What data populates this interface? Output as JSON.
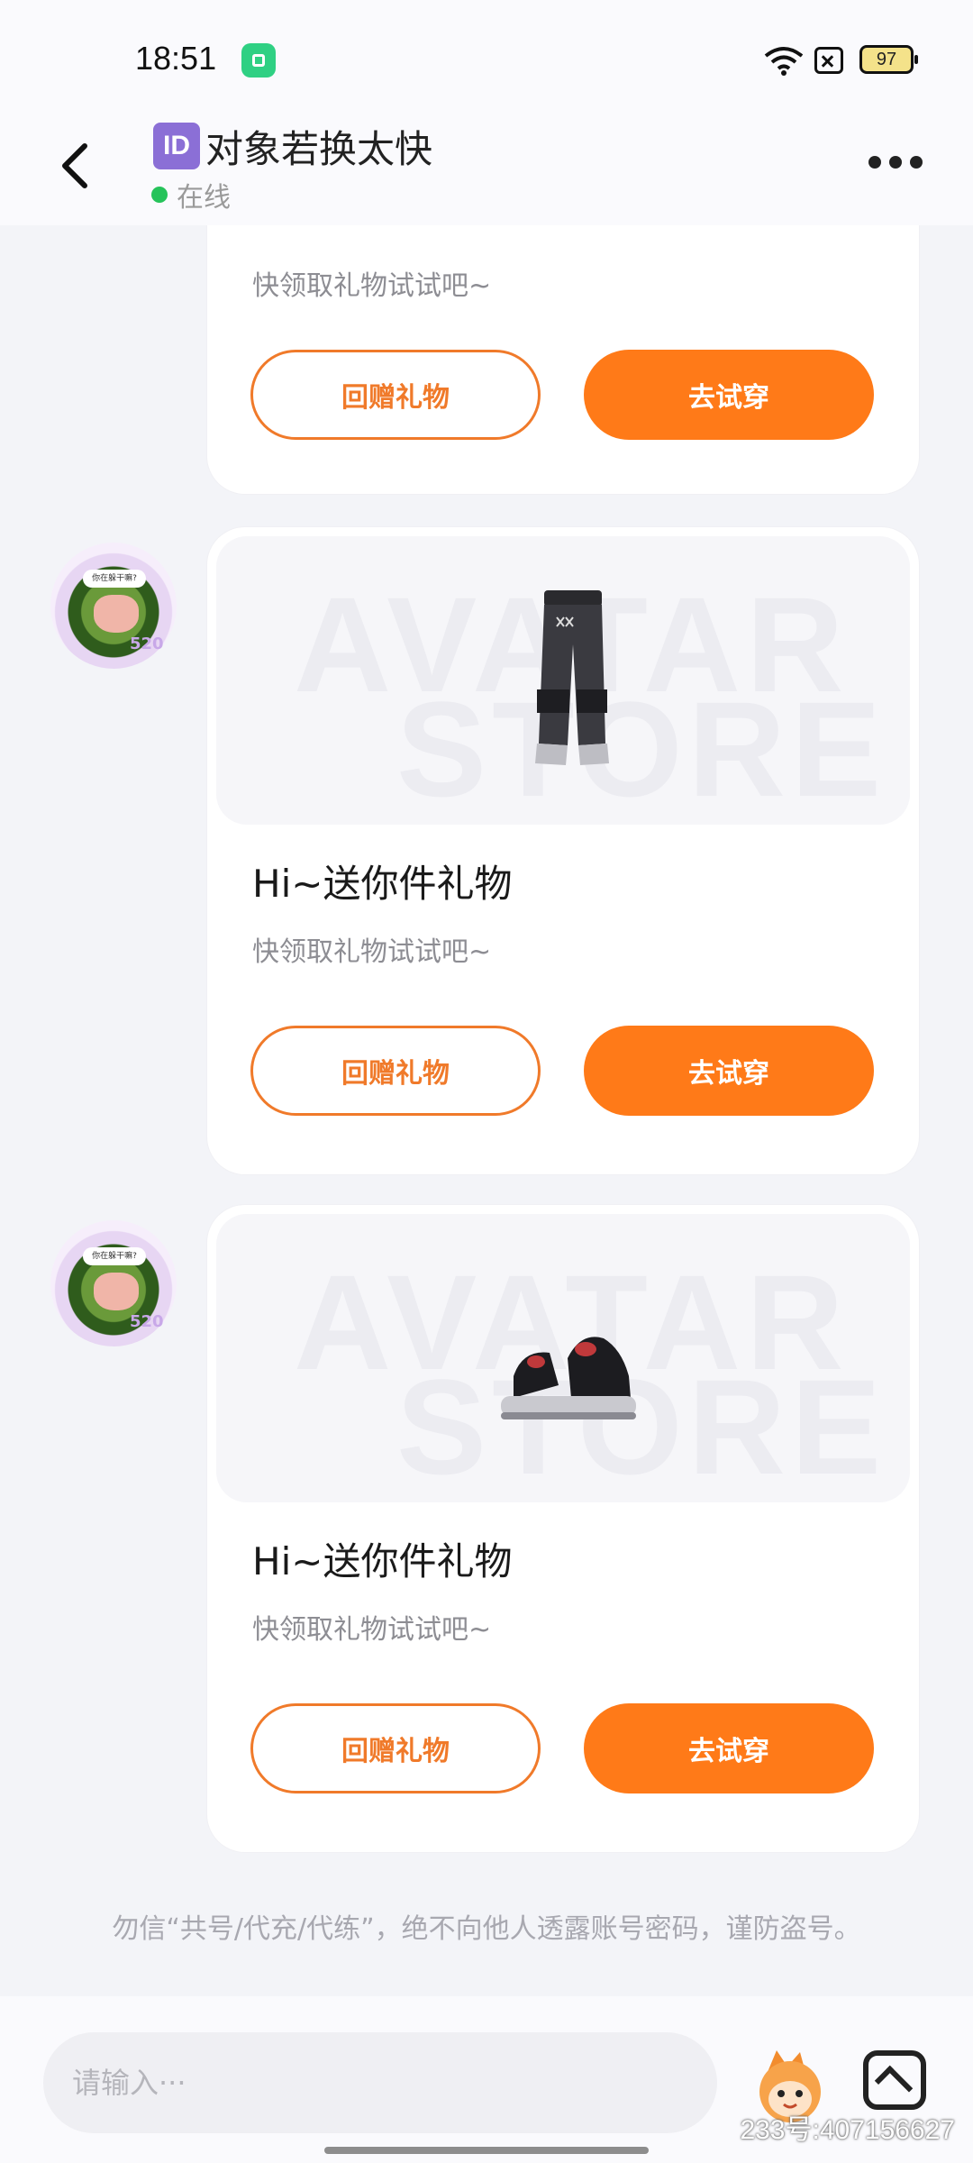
{
  "status_bar": {
    "time": "18:51",
    "battery": "97",
    "icons": [
      "app-notification-icon",
      "wifi-icon",
      "sim-icon",
      "battery-icon"
    ]
  },
  "header": {
    "id_badge": "ID",
    "title": "对象若换太快",
    "status": "在线"
  },
  "cards": [
    {
      "title": "",
      "subtitle": "快领取礼物试试吧~",
      "return_gift_label": "回赠礼物",
      "try_on_label": "去试穿"
    },
    {
      "title": "Hi~送你件礼物",
      "subtitle": "快领取礼物试试吧~",
      "return_gift_label": "回赠礼物",
      "try_on_label": "去试穿",
      "item": "pants"
    },
    {
      "title": "Hi~送你件礼物",
      "subtitle": "快领取礼物试试吧~",
      "return_gift_label": "回赠礼物",
      "try_on_label": "去试穿",
      "item": "shoes"
    }
  ],
  "image_watermark": [
    "AVATAR",
    "STORE"
  ],
  "avatar": {
    "bubble_text": "你在躲干嘛?",
    "number": "520"
  },
  "warning": "勿信“共号/代充/代练”，绝不向他人透露账号密码，谨防盗号。",
  "input": {
    "placeholder": "请输入···"
  },
  "footer": {
    "user_id": "233号:407156627"
  },
  "colors": {
    "accent": "#ff7a18",
    "background": "#f3f4f8",
    "online": "#26c35a"
  }
}
